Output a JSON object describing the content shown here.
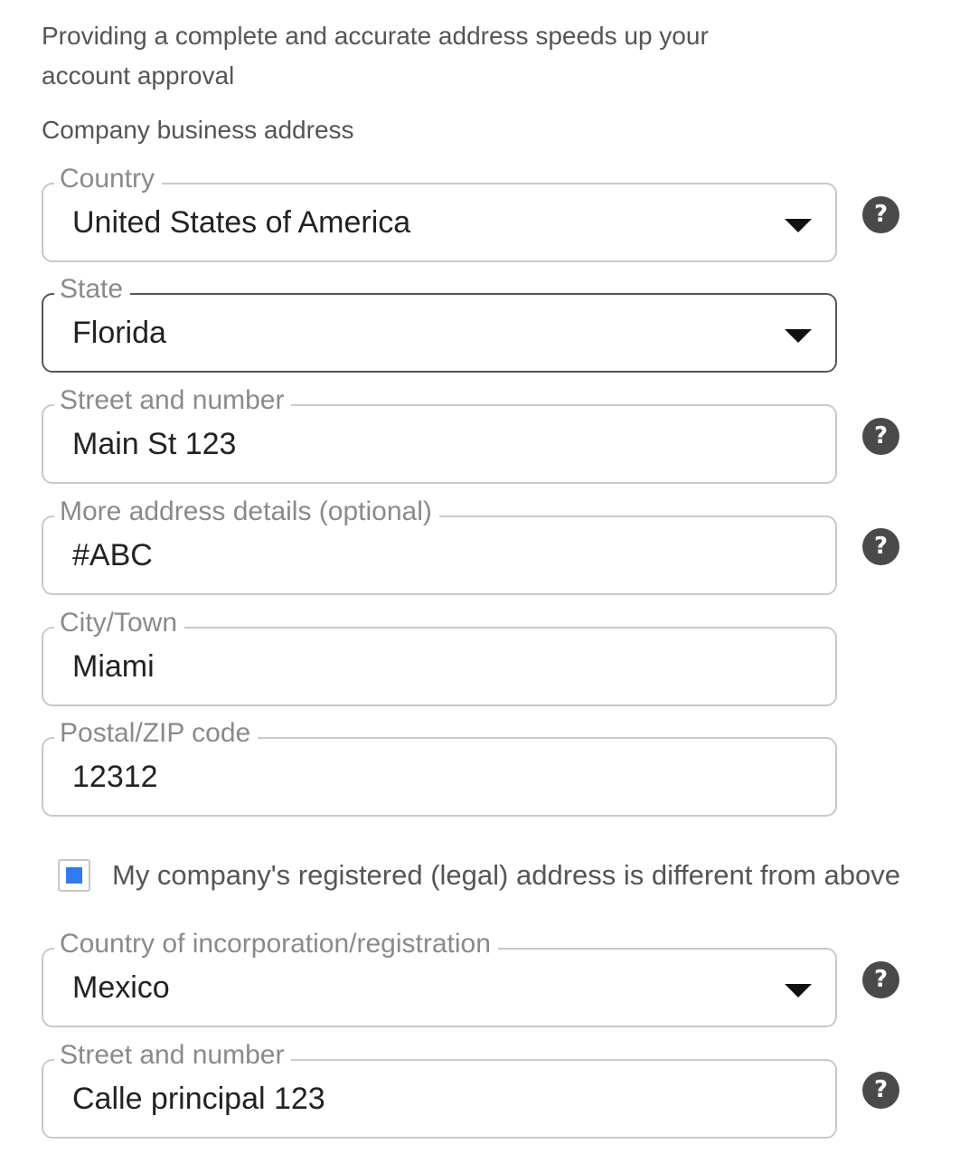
{
  "intro_text": "Providing a complete and accurate address speeds up your account approval",
  "section_label": "Company business address",
  "fields": [
    {
      "label": "Country",
      "value": "United States of America",
      "type": "select"
    },
    {
      "label": "State",
      "value": "Florida",
      "type": "select"
    },
    {
      "label": "Street and number",
      "value": "Main St 123",
      "type": "text"
    },
    {
      "label": "More address details (optional)",
      "value": "#ABC",
      "type": "text"
    },
    {
      "label": "City/Town",
      "value": "Miami",
      "type": "text"
    },
    {
      "label": "Postal/ZIP code",
      "value": "12312",
      "type": "text"
    }
  ],
  "checkbox": {
    "label": "My company's registered (legal) address is different from above",
    "checked": true,
    "color": "#2f7bf2"
  },
  "registered_fields": [
    {
      "label": "Country of incorporation/registration",
      "value": "Mexico",
      "type": "select"
    },
    {
      "label": "Street and number",
      "value": "Calle principal 123",
      "type": "text"
    }
  ],
  "help_icon_glyph": "?",
  "icons": [
    "help-icon",
    "chevron-down-icon"
  ]
}
